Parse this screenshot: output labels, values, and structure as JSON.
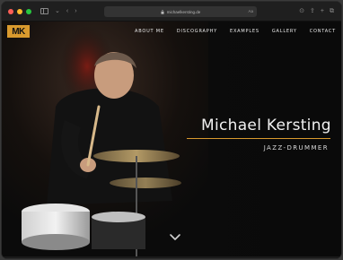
{
  "browser": {
    "url": "michaelkersting.de",
    "lock_icon": "lock-icon",
    "reader_icon": "Aa"
  },
  "site": {
    "logo": "MK",
    "nav": [
      "ABOUT ME",
      "DISCOGRAPHY",
      "EXAMPLES",
      "GALLERY",
      "CONTACT"
    ],
    "hero_title": "Michael Kersting",
    "hero_subtitle": "JAZZ-DRUMMER"
  },
  "colors": {
    "accent": "#d99a2e",
    "background": "#0a0a0a",
    "text": "#f1f1f1"
  }
}
